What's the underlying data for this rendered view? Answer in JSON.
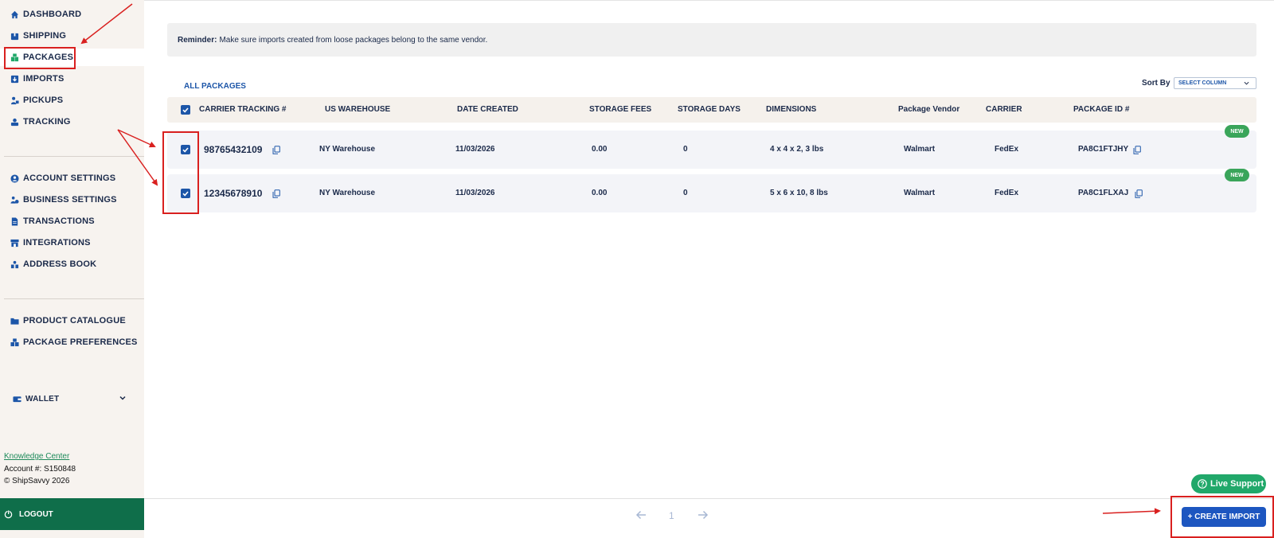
{
  "sidebar": {
    "nav_primary": [
      {
        "label": "DASHBOARD",
        "icon": "home-icon"
      },
      {
        "label": "SHIPPING",
        "icon": "shipping-icon"
      },
      {
        "label": "PACKAGES",
        "icon": "packages-icon",
        "active": true
      },
      {
        "label": "IMPORTS",
        "icon": "imports-icon"
      },
      {
        "label": "PICKUPS",
        "icon": "pickups-icon"
      },
      {
        "label": "TRACKING",
        "icon": "tracking-icon"
      }
    ],
    "nav_account": [
      {
        "label": "ACCOUNT SETTINGS",
        "icon": "user-icon"
      },
      {
        "label": "BUSINESS SETTINGS",
        "icon": "business-icon"
      },
      {
        "label": "TRANSACTIONS",
        "icon": "document-icon"
      },
      {
        "label": "INTEGRATIONS",
        "icon": "store-icon"
      },
      {
        "label": "ADDRESS BOOK",
        "icon": "address-book-icon"
      }
    ],
    "nav_catalog": [
      {
        "label": "PRODUCT CATALOGUE",
        "icon": "folder-icon"
      },
      {
        "label": "PACKAGE PREFERENCES",
        "icon": "boxes-icon"
      }
    ],
    "wallet_label": "WALLET",
    "knowledge_center": "Knowledge Center",
    "account_number": "Account #: S150848",
    "copyright": "© ShipSavvy 2026",
    "logout_label": "LOGOUT"
  },
  "reminder": {
    "prefix": "Reminder:",
    "text": "Make sure imports created from loose packages belong to the same vendor."
  },
  "tab_label": "ALL PACKAGES",
  "sort": {
    "label": "Sort By",
    "selected": "SELECT COLUMN"
  },
  "table": {
    "columns": [
      "CARRIER TRACKING #",
      "US WAREHOUSE",
      "DATE CREATED",
      "STORAGE FEES",
      "STORAGE DAYS",
      "DIMENSIONS",
      "Package Vendor",
      "CARRIER",
      "PACKAGE ID #"
    ],
    "rows": [
      {
        "tracking": "98765432109",
        "warehouse": "NY Warehouse",
        "date": "11/03/2026",
        "fees": "0.00",
        "days": "0",
        "dimensions": "4 x 4 x 2, 3 lbs",
        "vendor": "Walmart",
        "carrier": "FedEx",
        "package_id": "PA8C1FTJHY",
        "badge": "NEW",
        "checked": true
      },
      {
        "tracking": "12345678910",
        "warehouse": "NY Warehouse",
        "date": "11/03/2026",
        "fees": "0.00",
        "days": "0",
        "dimensions": "5 x 6 x 10, 8 lbs",
        "vendor": "Walmart",
        "carrier": "FedEx",
        "package_id": "PA8C1FLXAJ",
        "badge": "NEW",
        "checked": true
      }
    ]
  },
  "pagination": {
    "current_page": "1"
  },
  "live_support_label": "Live Support",
  "create_import_label": "+ CREATE IMPORT",
  "colors": {
    "sidebar_bg": "#f7f3ef",
    "logout_bg": "#0f6e4a",
    "brand_blue": "#1d56a8",
    "new_badge": "#3aa55a",
    "annotation_red": "#d9201f"
  }
}
